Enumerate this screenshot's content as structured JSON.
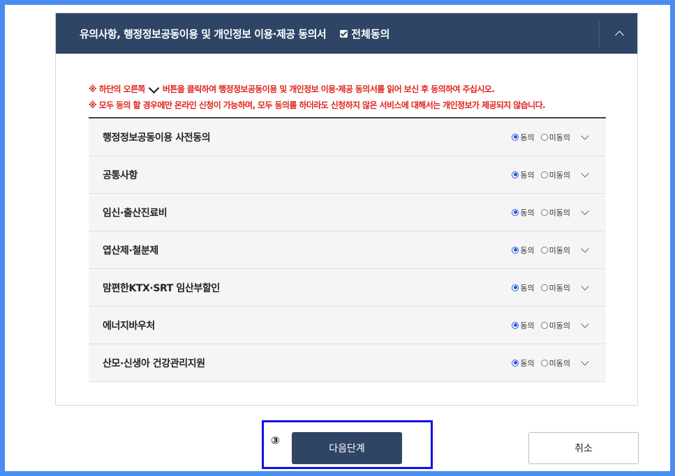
{
  "header": {
    "title": "유의사항, 행정정보공동이용 및 개인정보 이용·제공 동의서",
    "agree_all_label": "전체동의",
    "agree_all_checked": true,
    "collapse_icon": "chevron-up-icon"
  },
  "notices": {
    "line1_before": "※ 하단의 오른쪽",
    "line1_after": "버튼을 클릭하여 행정정보공동이용 및 개인정보 이용·제공 동의서를 읽어 보신 후 동의하여 주십시오.",
    "line2": "※ 모두 동의 할 경우에만 온라인 신청이 가능하며, 모두 동의를 하더라도 신청하지 않은 서비스에 대해서는 개인정보가 제공되지 않습니다."
  },
  "options": {
    "agree_label": "동의",
    "disagree_label": "미동의"
  },
  "items": [
    {
      "label": "행정정보공동이용 사전동의",
      "selected": "agree"
    },
    {
      "label": "공통사항",
      "selected": "agree"
    },
    {
      "label": "임신·출산진료비",
      "selected": "agree"
    },
    {
      "label": "엽산제·철분제",
      "selected": "agree"
    },
    {
      "label": "맘편한KTX·SRT 임산부할인",
      "selected": "agree"
    },
    {
      "label": "에너지바우처",
      "selected": "agree"
    },
    {
      "label": "산모·신생아 건강관리지원",
      "selected": "agree"
    }
  ],
  "footer": {
    "step_marker": "③",
    "next_label": "다음단계",
    "cancel_label": "취소"
  },
  "colors": {
    "header_bg": "#2e4566",
    "notice_text": "#e0231d",
    "highlight_box": "#1010e8",
    "frame": "#4a8df0"
  }
}
